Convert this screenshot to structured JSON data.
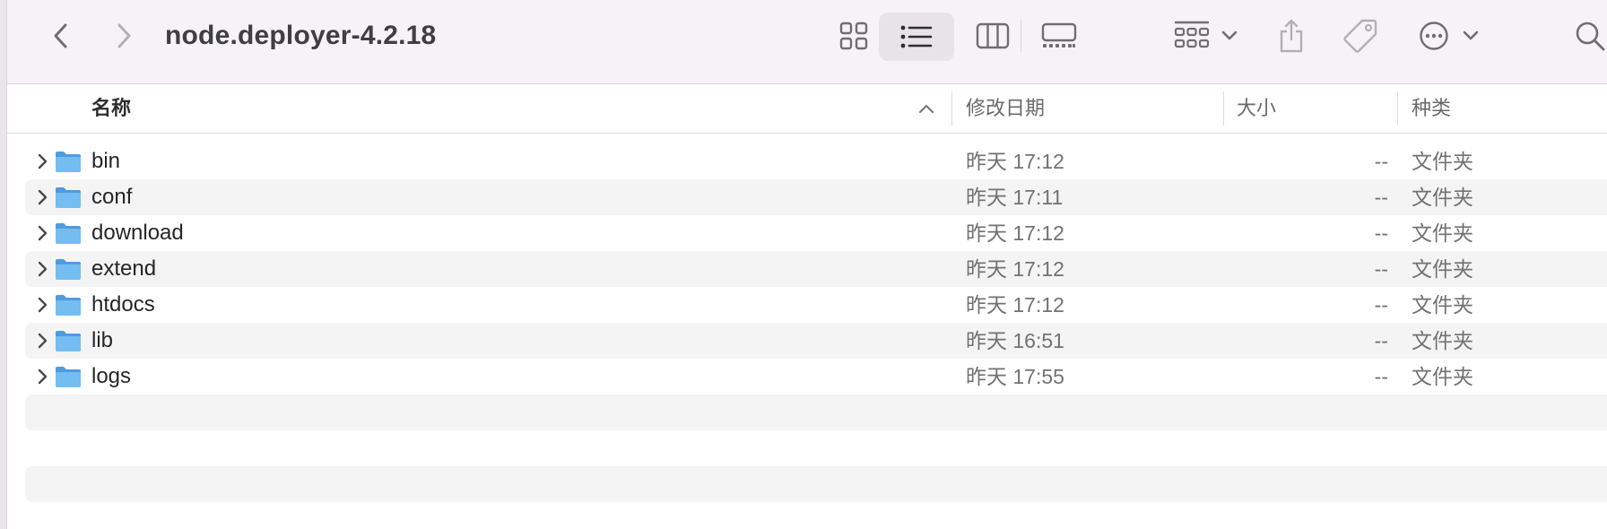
{
  "toolbar": {
    "title": "node.deployer-4.2.18",
    "icons": {
      "back": "chevron-left-icon",
      "forward": "chevron-right-icon",
      "view_icons": "grid-view-icon",
      "view_list": "list-view-icon",
      "view_columns": "column-view-icon",
      "view_gallery": "gallery-view-icon",
      "group": "group-by-icon",
      "share": "share-icon",
      "tags": "tag-icon",
      "more": "ellipsis-circle-icon",
      "search": "search-icon"
    }
  },
  "columns": {
    "name": "名称",
    "date_modified": "修改日期",
    "size": "大小",
    "kind": "种类"
  },
  "files": [
    {
      "name": "bin",
      "date": "昨天 17:12",
      "size": "--",
      "kind": "文件夹"
    },
    {
      "name": "conf",
      "date": "昨天 17:11",
      "size": "--",
      "kind": "文件夹"
    },
    {
      "name": "download",
      "date": "昨天 17:12",
      "size": "--",
      "kind": "文件夹"
    },
    {
      "name": "extend",
      "date": "昨天 17:12",
      "size": "--",
      "kind": "文件夹"
    },
    {
      "name": "htdocs",
      "date": "昨天 17:12",
      "size": "--",
      "kind": "文件夹"
    },
    {
      "name": "lib",
      "date": "昨天 16:51",
      "size": "--",
      "kind": "文件夹"
    },
    {
      "name": "logs",
      "date": "昨天 17:55",
      "size": "--",
      "kind": "文件夹"
    }
  ],
  "colors": {
    "toolbar_bg": "#f6f2f7",
    "folder_blue": "#6fb6ec",
    "stripe": "#f3f4f3"
  }
}
